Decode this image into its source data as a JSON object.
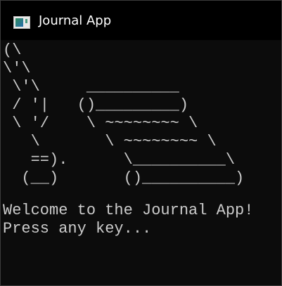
{
  "window": {
    "title": "Journal App",
    "icon": "console-window-icon"
  },
  "console": {
    "art": [
      "(\\",
      "\\'\\",
      " \\'\\     __________",
      " / '|   ()_________)",
      " \\ '/    \\ ~~~~~~~~ \\",
      "   \\       \\ ~~~~~~~~ \\",
      "   ==).      \\__________\\",
      "  (__)       ()__________)"
    ],
    "welcome": "Welcome to the Journal App!",
    "prompt": "Press any key..."
  }
}
